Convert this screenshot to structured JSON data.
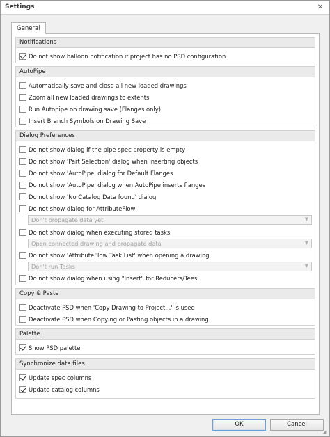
{
  "window": {
    "title": "Settings",
    "close_glyph": "✕"
  },
  "tabs": [
    {
      "label": "General"
    }
  ],
  "groups": {
    "notifications": {
      "title": "Notifications",
      "items": [
        {
          "label": "Do not show balloon notification if project has no PSD configuration",
          "checked": true
        }
      ]
    },
    "autopipe": {
      "title": "AutoPipe",
      "items": [
        {
          "label": "Automatically save and close all new loaded drawings",
          "checked": false
        },
        {
          "label": "Zoom all new loaded drawings to extents",
          "checked": false
        },
        {
          "label": "Run Autopipe on drawing save (Flanges only)",
          "checked": false
        },
        {
          "label": "Insert Branch Symbols on Drawing Save",
          "checked": false
        }
      ]
    },
    "dialog": {
      "title": "Dialog Preferences",
      "items": [
        {
          "label": "Do not show dialog if the pipe spec property is empty",
          "checked": false
        },
        {
          "label": "Do not show 'Part Selection' dialog when inserting objects",
          "checked": false
        },
        {
          "label": "Do not show 'AutoPipe' dialog for Default Flanges",
          "checked": false
        },
        {
          "label": "Do not show 'AutoPipe' dialog when AutoPipe inserts flanges",
          "checked": false
        },
        {
          "label": "Do not show 'No Catalog Data found' dialog",
          "checked": false
        },
        {
          "label": "Do not show dialog for AttributeFlow",
          "checked": false
        },
        {
          "label": "Do not show dialog when executing stored tasks",
          "checked": false
        },
        {
          "label": "Do not show 'AttributeFlow Task List' when opening a drawing",
          "checked": false
        },
        {
          "label": "Do not show dialog when using \"Insert\" for Reducers/Tees",
          "checked": false
        }
      ],
      "combos": [
        {
          "value": "Don't propagate data yet"
        },
        {
          "value": "Open connected drawing and propagate data"
        },
        {
          "value": "Don't run Tasks"
        }
      ]
    },
    "copy_paste": {
      "title": "Copy & Paste",
      "items": [
        {
          "label": "Deactivate PSD when 'Copy Drawing to Project...' is used",
          "checked": false
        },
        {
          "label": "Deactivate PSD when Copying or Pasting objects in a drawing",
          "checked": false
        }
      ]
    },
    "palette": {
      "title": "Palette",
      "items": [
        {
          "label": "Show PSD palette",
          "checked": true
        }
      ]
    },
    "sync": {
      "title": "Synchronize data files",
      "items": [
        {
          "label": "Update spec columns",
          "checked": true
        },
        {
          "label": "Update catalog columns",
          "checked": true
        }
      ]
    }
  },
  "buttons": {
    "ok": "OK",
    "cancel": "Cancel"
  },
  "icons": {
    "close": "close-icon",
    "dropdown": "chevron-down-icon",
    "check": "checkmark-icon"
  }
}
